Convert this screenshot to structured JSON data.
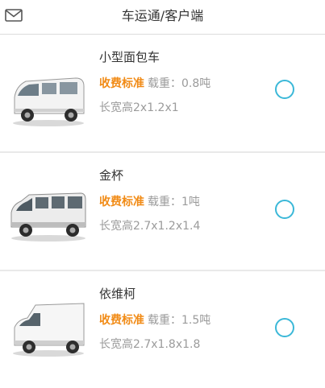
{
  "header": {
    "title": "车运通/客户端",
    "icon": "mail-icon"
  },
  "vehicles": [
    {
      "name": "小型面包车",
      "fee_label": "收费标准",
      "load": "载重：0.8吨",
      "dims": "长宽高2x1.2x1",
      "selected": false
    },
    {
      "name": "金杯",
      "fee_label": "收费标准",
      "load": "载重：1吨",
      "dims": "长宽高2.7x1.2x1.4",
      "selected": false
    },
    {
      "name": "依维柯",
      "fee_label": "收费标准",
      "load": "载重：1.5吨",
      "dims": "长宽高2.7x1.8x1.8",
      "selected": false
    }
  ],
  "colors": {
    "accent": "#f18b16",
    "radio": "#3bb8d8",
    "muted": "#9b9b9b"
  }
}
